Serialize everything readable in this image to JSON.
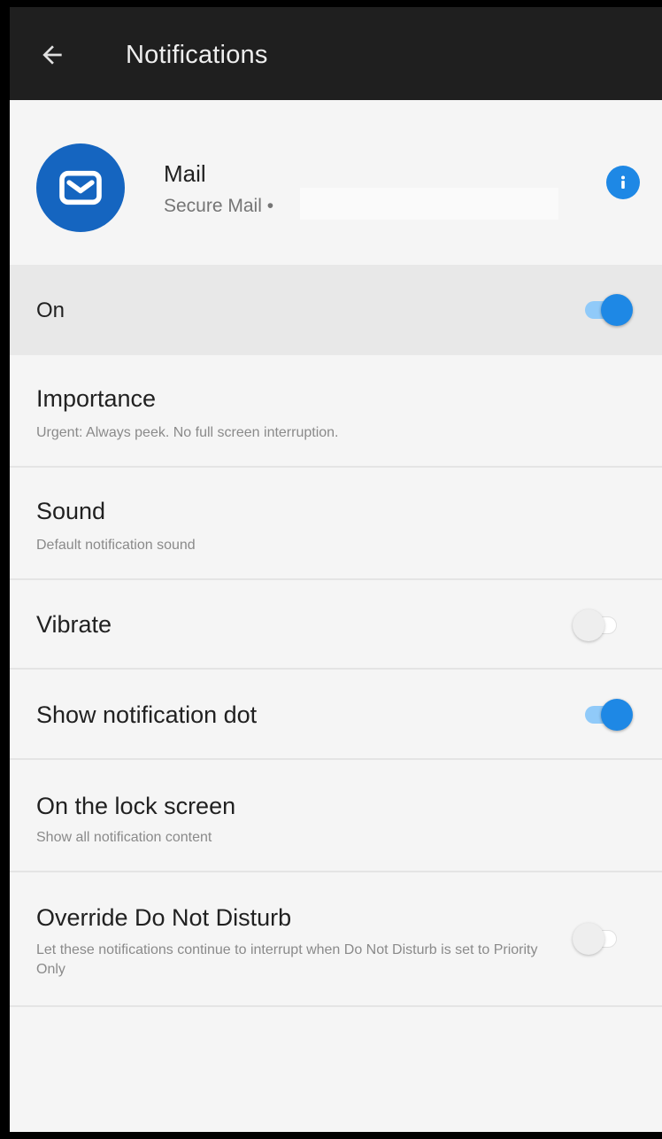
{
  "appbar": {
    "title": "Notifications",
    "back_icon": "arrow-left-icon"
  },
  "app": {
    "name": "Mail",
    "subtitle": "Secure Mail •",
    "icon": "mail-icon",
    "icon_color": "#1565c0",
    "info_icon": "info-icon"
  },
  "master": {
    "label": "On",
    "state": "on"
  },
  "settings": [
    {
      "title": "Importance",
      "subtitle": "Urgent: Always peek. No full screen interruption."
    },
    {
      "title": "Sound",
      "subtitle": "Default notification sound"
    },
    {
      "title": "Vibrate",
      "toggle": "off"
    },
    {
      "title": "Show notification dot",
      "toggle": "on"
    },
    {
      "title": "On the lock screen",
      "subtitle": "Show all notification content"
    },
    {
      "title": "Override Do Not Disturb",
      "subtitle": "Let these notifications continue to interrupt when Do Not Disturb is set to Priority Only",
      "toggle": "off"
    }
  ],
  "colors": {
    "accent": "#1e88e5",
    "appbar": "#1f1f1f",
    "background": "#f5f5f5"
  }
}
